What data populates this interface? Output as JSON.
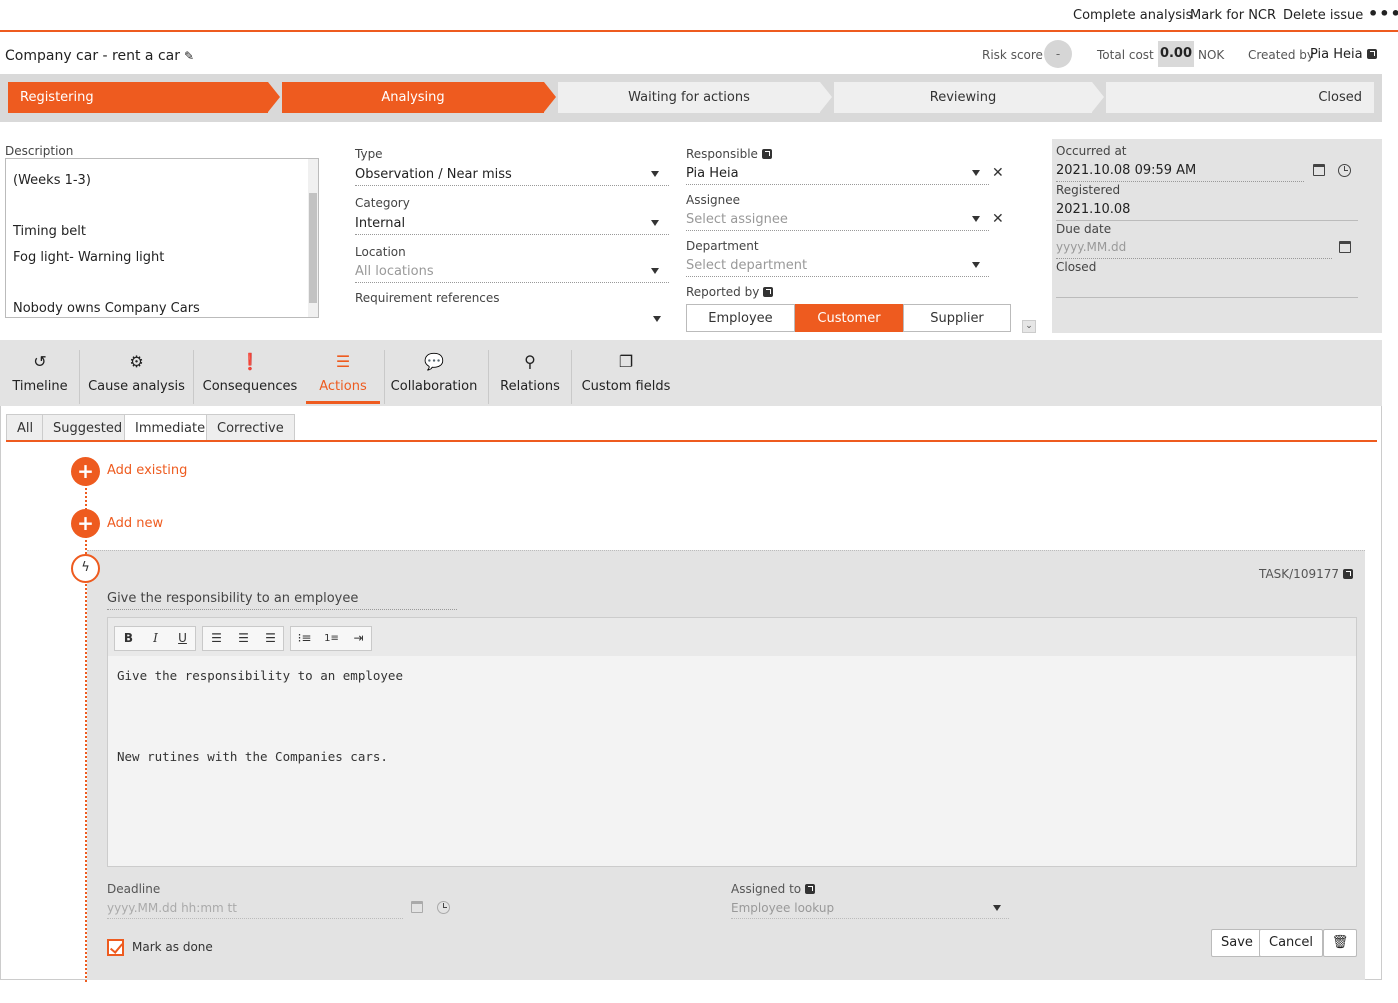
{
  "topbar": {
    "complete_analysis": "Complete analysis",
    "mark_ncr": "Mark for NCR",
    "delete_issue": "Delete issue",
    "more": "•••"
  },
  "header": {
    "title": "Company car - rent a car",
    "risk_label": "Risk score",
    "risk_value": "-",
    "cost_label": "Total cost",
    "cost_value": "0.00",
    "currency": "NOK",
    "created_label": "Created by",
    "created_by": "Pia Heia"
  },
  "workflow": {
    "steps": [
      {
        "label": "Registering",
        "state": "done"
      },
      {
        "label": "Analysing",
        "state": "current"
      },
      {
        "label": "Waiting for actions",
        "state": "todo"
      },
      {
        "label": "Reviewing",
        "state": "todo"
      },
      {
        "label": "Closed",
        "state": "todo"
      }
    ]
  },
  "form": {
    "description_label": "Description",
    "description_text": "(Weeks 1-3)\n\nTiming belt\nFog light- Warning light\n\nNobody owns Company Cars",
    "type_label": "Type",
    "type_value": "Observation / Near miss",
    "category_label": "Category",
    "category_value": "Internal",
    "location_label": "Location",
    "location_placeholder": "All locations",
    "requirement_label": "Requirement references",
    "responsible_label": "Responsible",
    "responsible_value": "Pia  Heia",
    "assignee_label": "Assignee",
    "assignee_placeholder": "Select assignee",
    "department_label": "Department",
    "department_placeholder": "Select department",
    "reported_by_label": "Reported by",
    "reported_by_options": [
      "Employee",
      "Customer",
      "Supplier"
    ],
    "reported_by_selected": "Customer",
    "occurred_label": "Occurred at",
    "occurred_value": "2021.10.08 09:59 AM",
    "registered_label": "Registered",
    "registered_value": "2021.10.08",
    "due_label": "Due date",
    "due_placeholder": "yyyy.MM.dd",
    "closed_label": "Closed"
  },
  "tabs": [
    {
      "label": "Timeline",
      "icon": "history-icon"
    },
    {
      "label": "Cause analysis",
      "icon": "analysis-icon"
    },
    {
      "label": "Consequences",
      "icon": "exclamation-icon"
    },
    {
      "label": "Actions",
      "icon": "list-icon"
    },
    {
      "label": "Collaboration",
      "icon": "chat-icon"
    },
    {
      "label": "Relations",
      "icon": "relations-icon"
    },
    {
      "label": "Custom fields",
      "icon": "custom-fields-icon"
    }
  ],
  "active_tab": "Actions",
  "subtabs": [
    "All",
    "Suggested",
    "Immediate",
    "Corrective"
  ],
  "active_subtab": "Immediate",
  "actions": {
    "add_existing": "Add existing",
    "add_new": "Add new"
  },
  "task": {
    "id": "TASK/109177",
    "title": "Give the responsibility to an employee",
    "body": "Give the responsibility to an employee\n\n\nNew rutines with the Companies cars.",
    "deadline_label": "Deadline",
    "deadline_placeholder": "yyyy.MM.dd hh:mm tt",
    "assigned_label": "Assigned to",
    "assigned_placeholder": "Employee lookup",
    "mark_done_label": "Mark as done",
    "mark_done_checked": true,
    "save_label": "Save",
    "cancel_label": "Cancel"
  },
  "colors": {
    "accent": "#ee5b1f",
    "panel": "#e3e3e3"
  }
}
